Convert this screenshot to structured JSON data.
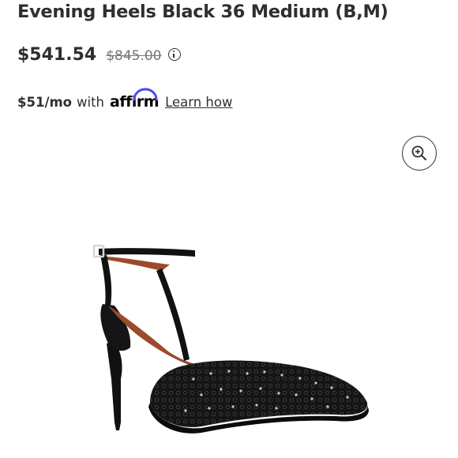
{
  "product": {
    "title": "Evening Heels Black 36 Medium (B,M)",
    "price_current": "$541.54",
    "price_was": "$845.00",
    "info_icon": "info-circle-icon"
  },
  "financing": {
    "monthly": "$51/mo",
    "with": "with",
    "provider": "affirm",
    "learn_link": "Learn how"
  },
  "image": {
    "zoom_icon": "zoom-in-icon",
    "subject": "black embellished slingback heel"
  },
  "colors": {
    "text": "#2e2f32",
    "strike": "#74767c",
    "affirm_arc": "#4a4af4",
    "shoe": "#111111",
    "lining": "#9b4a2c"
  }
}
